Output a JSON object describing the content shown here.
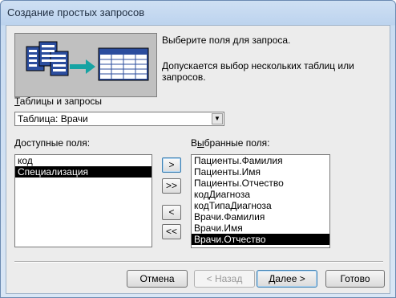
{
  "window": {
    "title": "Создание простых запросов"
  },
  "description": {
    "line1": "Выберите поля для запроса.",
    "line2": "Допускается выбор нескольких таблиц или запросов."
  },
  "tables": {
    "label_first": "Т",
    "label_rest": "аблицы и запросы",
    "selected": "Таблица: Врачи"
  },
  "available": {
    "label_first": "Д",
    "label_rest": "оступные поля:",
    "items": [
      "код",
      "Специализация"
    ],
    "selected_index": 1
  },
  "selected_fields": {
    "label_pre": "В",
    "label_ul": "ы",
    "label_post": "бранные поля:",
    "items": [
      "Пациенты.Фамилия",
      "Пациенты.Имя",
      "Пациенты.Отчество",
      "кодДиагноза",
      "кодТипаДиагноза",
      "Врачи.Фамилия",
      "Врачи.Имя",
      "Врачи.Отчество"
    ],
    "selected_index": 7
  },
  "move_buttons": {
    "add": ">",
    "add_all": ">>",
    "remove": "<",
    "remove_all": "<<"
  },
  "footer": {
    "cancel": "Отмена",
    "back": "< Назад",
    "next": "Далее >",
    "finish": "Готово"
  }
}
